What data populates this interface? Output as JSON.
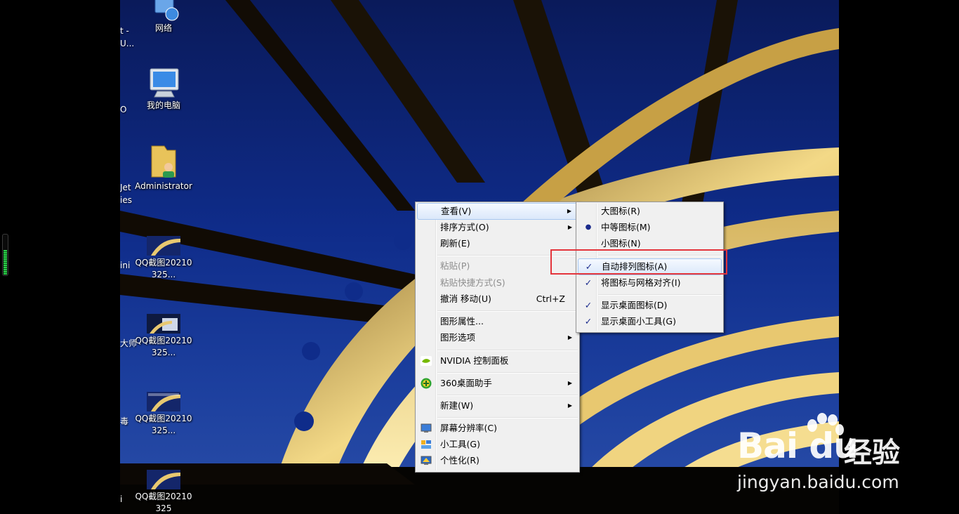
{
  "desktop": {
    "icons_right_column": [
      {
        "name": "network",
        "label": "网络"
      },
      {
        "name": "computer",
        "label": "我的电脑"
      },
      {
        "name": "admin-folder",
        "label": "Administrator"
      },
      {
        "name": "qq-screenshot-1",
        "label": "QQ截图20210325..."
      },
      {
        "name": "qq-screenshot-2",
        "label": "QQ截图20210325..."
      },
      {
        "name": "qq-screenshot-3",
        "label": "QQ截图20210325..."
      },
      {
        "name": "qq-screenshot-4",
        "label": "QQ截图20210325"
      }
    ],
    "partial_labels": [
      "t -",
      "U...",
      "O",
      "Jet",
      "ies",
      "ini",
      "大师",
      "毒",
      "i"
    ]
  },
  "context_menu": {
    "items": {
      "view": "查看(V)",
      "sort": "排序方式(O)",
      "refresh": "刷新(E)",
      "paste": "粘贴(P)",
      "paste_shortcut": "粘贴快捷方式(S)",
      "undo": "撤消 移动(U)",
      "undo_shortcut": "Ctrl+Z",
      "graphics_properties": "图形属性...",
      "graphics_options": "图形选项",
      "nvidia": "NVIDIA 控制面板",
      "desktop_360": "360桌面助手",
      "new": "新建(W)",
      "resolution": "屏幕分辨率(C)",
      "gadgets": "小工具(G)",
      "personalize": "个性化(R)"
    }
  },
  "view_submenu": {
    "items": {
      "large": "大图标(R)",
      "medium": "中等图标(M)",
      "small": "小图标(N)",
      "auto_arrange": "自动排列图标(A)",
      "align_grid": "将图标与网格对齐(I)",
      "show_icons": "显示桌面图标(D)",
      "show_gadgets": "显示桌面小工具(G)"
    }
  },
  "watermark": {
    "brand": "Bai du",
    "product": "经验",
    "url": "jingyan.baidu.com"
  },
  "colors": {
    "highlight_box": "#e4353c",
    "check_mark": "#1a2a8c",
    "menu_bg": "#f0f0f0"
  }
}
